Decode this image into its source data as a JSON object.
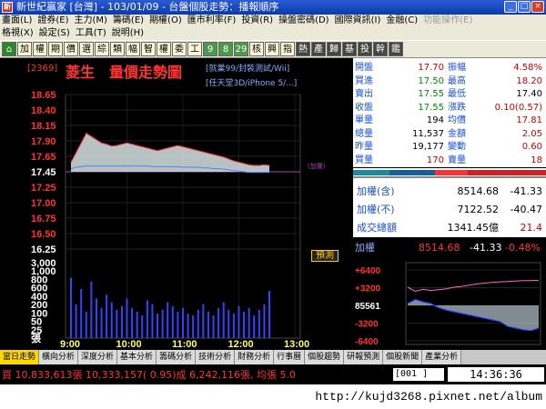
{
  "window": {
    "title": "新世紀贏家 [台灣] - 103/01/09 - 台盤個股走勢：播報順序",
    "buttons": [
      "_",
      "□",
      "×"
    ]
  },
  "menu": {
    "row1": [
      "畫面(L)",
      "證券(E)",
      "主力(M)",
      "籌碼(E)",
      "期權(O)",
      "匯市利率(F)",
      "投資(R)",
      "操盤密碼(D)",
      "國際資訊(I)",
      "金融(C)",
      "功能操作(E)"
    ],
    "row1_dim": [
      false,
      false,
      false,
      false,
      false,
      false,
      false,
      false,
      false,
      false,
      true
    ],
    "row2": [
      "格視(X)",
      "設定(S)",
      "工具(T)",
      "說明(H)"
    ]
  },
  "toolbar": {
    "items": [
      "⌂",
      "加",
      "權",
      "期",
      "價",
      "選",
      "綜",
      "類",
      "幅",
      "智",
      "權",
      "委",
      "工",
      "9",
      "8",
      "29",
      "核",
      "興",
      "指",
      "熱",
      "產",
      "歸",
      "基",
      "投",
      "幹",
      "鑑"
    ]
  },
  "stock": {
    "code": "[2369]",
    "name": "菱生",
    "chart_title": "量價走勢圖",
    "industry": "[就業99/封裝測試/Wii]",
    "concept": "[任天堂3D/iPhone 5/...]",
    "forecast_label": "預測"
  },
  "quote": {
    "rows": [
      {
        "l1": "開盤",
        "v1": "17.70",
        "l2": "振幅",
        "v2": "4.58%",
        "c1": "#cc0000",
        "c2": "#cc0000"
      },
      {
        "l1": "買進",
        "v1": "17.50",
        "l2": "最高",
        "v2": "18.20",
        "c1": "#008800",
        "c2": "#cc0000"
      },
      {
        "l1": "賣出",
        "v1": "17.55",
        "l2": "最低",
        "v2": "17.40",
        "c1": "#008800",
        "c2": "#000000"
      },
      {
        "l1": "收盤",
        "v1": "17.55",
        "l2": "漲跌",
        "v2": "0.10(0.57)",
        "c1": "#008800",
        "c2": "#cc0000"
      },
      {
        "l1": "單量",
        "v1": "194",
        "l2": "均價",
        "v2": "17.81",
        "c1": "#000000",
        "c2": "#cc0000"
      },
      {
        "l1": "總量",
        "v1": "11,537",
        "l2": "金額",
        "v2": "2.05",
        "c1": "#000000",
        "c2": "#cc0000"
      },
      {
        "l1": "昨量",
        "v1": "19,177",
        "l2": "變動",
        "v2": "0.60",
        "c1": "#000000",
        "c2": "#cc0000"
      },
      {
        "l1": "買量",
        "v1": "170",
        "l2": "賣量",
        "v2": "18",
        "c1": "#cc0000",
        "c2": "#cc0000"
      }
    ]
  },
  "index_panel": {
    "rows": [
      {
        "label": "加權(含)",
        "v1": "8514.68",
        "v2": "-41.33",
        "c2": "#000000"
      },
      {
        "label": "加權(不)",
        "v1": "7122.52",
        "v2": "-40.47",
        "c2": "#000000"
      },
      {
        "label": "成交總額",
        "v1": "1341.45億",
        "v2": "21.4",
        "c2": "#cc0000"
      }
    ]
  },
  "mini_chart": {
    "label": "加權",
    "value": "8514.68",
    "change": "-41.33",
    "pct": "-0.48%",
    "y_labels": [
      "+6400",
      "+3200",
      "85561",
      "-3200",
      "-6400"
    ],
    "upper_series": [
      0.6,
      0.7,
      0.65,
      0.68,
      0.66,
      0.64,
      0.6,
      0.58,
      0.55,
      0.52,
      0.5,
      0.48,
      0.47,
      0.46,
      0.45,
      0.44,
      0.44,
      0.43
    ],
    "lower_series": [
      0.5,
      0.45,
      0.48,
      0.5,
      0.55,
      0.58,
      0.6,
      0.62,
      0.64,
      0.66,
      0.68,
      0.7,
      0.72,
      0.78,
      0.8,
      0.82,
      0.83,
      0.8
    ]
  },
  "chart_data": {
    "type": "line",
    "title": "量價走勢圖",
    "price_ticks": [
      "18.65",
      "18.40",
      "18.15",
      "17.90",
      "17.65",
      "17.45",
      "17.25",
      "17.00",
      "16.75",
      "16.50",
      "16.25"
    ],
    "volume_ticks": [
      "3,000",
      "1,000",
      "800",
      "600",
      "400",
      "200",
      "100",
      "50",
      "25",
      "張"
    ],
    "x_ticks": [
      "9:00",
      "10:00",
      "11:00",
      "12:00",
      "13:00"
    ],
    "ref_price": 17.45,
    "ref_label": "(加權)",
    "ylim": [
      16.25,
      18.65
    ],
    "price": [
      17.6,
      17.75,
      17.9,
      18.05,
      18.0,
      17.95,
      17.9,
      17.88,
      17.85,
      17.86,
      17.88,
      17.9,
      17.88,
      17.86,
      17.84,
      17.82,
      17.8,
      17.78,
      17.8,
      17.82,
      17.84,
      17.86,
      17.84,
      17.82,
      17.8,
      17.78,
      17.76,
      17.74,
      17.72,
      17.7,
      17.68,
      17.65,
      17.62,
      17.6,
      17.58,
      17.56,
      17.55,
      17.55,
      17.56,
      17.55
    ],
    "avg": [
      17.5,
      17.52,
      17.53,
      17.54,
      17.54,
      17.54,
      17.54,
      17.54,
      17.54,
      17.54,
      17.54,
      17.54,
      17.54,
      17.54,
      17.54,
      17.54,
      17.53,
      17.53,
      17.53,
      17.53,
      17.53,
      17.53,
      17.52,
      17.52,
      17.52,
      17.52,
      17.51,
      17.51,
      17.5,
      17.5,
      17.49,
      17.48,
      17.47,
      17.46,
      17.45,
      17.44,
      17.44,
      17.44,
      17.44,
      17.44
    ],
    "volume": [
      320,
      180,
      260,
      140,
      300,
      210,
      160,
      230,
      190,
      150,
      170,
      210,
      160,
      140,
      120,
      200,
      180,
      130,
      150,
      190,
      170,
      140,
      160,
      130,
      120,
      150,
      180,
      140,
      120,
      160,
      190,
      150,
      130,
      170,
      140,
      160,
      120,
      150,
      180,
      250
    ]
  },
  "tabs": {
    "items": [
      "當日走勢",
      "橫向分析",
      "深度分析",
      "基本分析",
      "籌碼分析",
      "技術分析",
      "財務分析",
      "行事曆",
      "個股趨勢",
      "研報預測",
      "個股新聞",
      "產業分析"
    ],
    "active": 0
  },
  "ticker": {
    "text": "買 10,833,613張 10,333,157( 0.95)成 6,242,116張, 均張 5.0",
    "pager": "[001   ]",
    "clock": "14:36:36"
  },
  "watermark": "http://kujd3268.pixnet.net/album"
}
